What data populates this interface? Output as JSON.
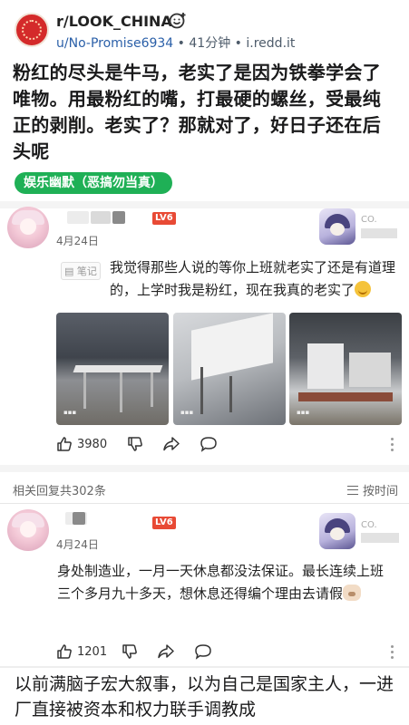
{
  "post": {
    "subreddit": "r/LOOK_CHINA",
    "user": "u/No-Promise6934",
    "age": "41分钟",
    "domain": "i.redd.it",
    "separator": "•",
    "title": "粉红的尽头是牛马，老实了是因为铁拳学会了唯物。用最粉红的嘴，打最硬的螺丝，受最纯正的剥削。老实了？那就对了，好日子还在后头呢",
    "flair": "娱乐幽默（恶搞勿当真）"
  },
  "comment1": {
    "level": "LV6",
    "date": "4月24日",
    "badge_label": "CO.",
    "note_tag": "笔记",
    "text": "我觉得那些人说的等你上班就老实了还是有道理的，上学时我是粉红，现在我真的老实了",
    "likes": "3980",
    "photos": [
      "factory-tables-photo",
      "sheet-metal-photo",
      "machinery-photo"
    ]
  },
  "replies": {
    "header": "相关回复共302条",
    "sort_label": "按时间"
  },
  "comment2": {
    "level": "LV6",
    "date": "4月24日",
    "badge_label": "CO.",
    "text": "身处制造业，一月一天休息都没法保证。最长连续上班三个多月九十多天，想休息还得编个理由去请假",
    "likes": "1201"
  },
  "bottom_text": "以前满脑子宏大叙事，以为自己是国家主人，一进厂直接被资本和权力联手调教成",
  "colors": {
    "flair_bg": "#1fb056",
    "level_badge": "#e84a35",
    "username": "#2a5fa8",
    "subreddit_icon": "#d42a2a"
  }
}
